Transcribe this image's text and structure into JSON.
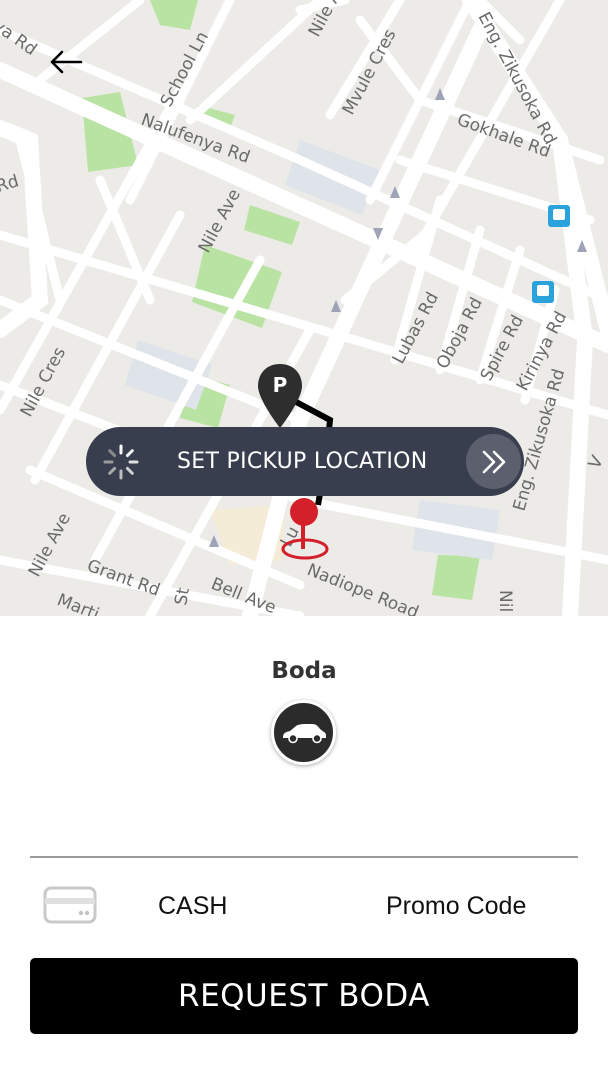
{
  "map": {
    "streets": [
      "ya Rd",
      "School Ln",
      "Nile Ave",
      "Mvule Cres",
      "Eng. Zikusoka Rd",
      "Gokhale Rd",
      "Nalufenya Rd",
      "Rd",
      "Nile Ave",
      "Nile Cres",
      "Lubas Rd",
      "Oboja Rd",
      "Spire Rd",
      "Kirinya Rd",
      "Eng. Zikusoka Rd",
      "Nile Ave",
      "Grant Rd",
      "Bell Ave",
      "Nadiope Road",
      "Marti",
      "St",
      "Lu",
      "Nil",
      "V"
    ],
    "parking_marker": "P",
    "transit_icon_name": "bus-stop-icon"
  },
  "back_icon": "arrow-left-icon",
  "pickup": {
    "label": "SET PICKUP LOCATION",
    "spinner_icon": "loading-spinner-icon",
    "go_icon": "double-chevron-right-icon"
  },
  "service": {
    "name": "Boda",
    "icon": "car-icon"
  },
  "payment": {
    "icon": "credit-card-icon",
    "method": "CASH",
    "promo": "Promo Code"
  },
  "request_button": "REQUEST BODA",
  "colors": {
    "pickup_bar": "#393e4f",
    "pin": "#d3202a",
    "request_button": "#000000",
    "map_background": "#ecebe8",
    "park": "#b9e3a2"
  }
}
